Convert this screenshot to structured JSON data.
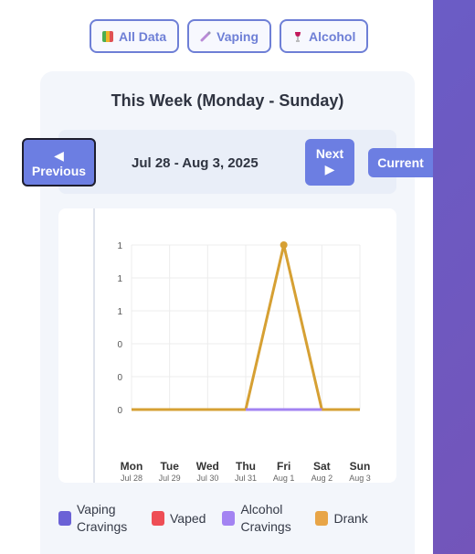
{
  "filters": [
    {
      "label": "All Data",
      "icon": "bar-chart-icon"
    },
    {
      "label": "Vaping",
      "icon": "vape-icon"
    },
    {
      "label": "Alcohol",
      "icon": "wine-glass-icon"
    }
  ],
  "card": {
    "title": "This Week (Monday - Sunday)",
    "range": "Jul 28 - Aug 3, 2025",
    "prev_arrow": "◀",
    "prev_label": "Previous",
    "next_label": "Next",
    "next_arrow": "▶",
    "current_label": "Current"
  },
  "chart_data": {
    "type": "line",
    "categories": [
      "Mon",
      "Tue",
      "Wed",
      "Thu",
      "Fri",
      "Sat",
      "Sun"
    ],
    "dates": [
      "Jul 28",
      "Jul 29",
      "Jul 30",
      "Jul 31",
      "Aug 1",
      "Aug 2",
      "Aug 3"
    ],
    "ytick_labels": [
      "1",
      "1",
      "1",
      "0",
      "0",
      "0"
    ],
    "ylim": [
      0,
      1
    ],
    "grid": true,
    "series": [
      {
        "name": "Vaping Cravings",
        "color": "#6b62d6",
        "values": [
          0,
          0,
          0,
          0,
          0,
          0,
          0
        ]
      },
      {
        "name": "Vaped",
        "color": "#ee4e55",
        "values": [
          0,
          0,
          0,
          0,
          0,
          0,
          0
        ]
      },
      {
        "name": "Alcohol Cravings",
        "color": "#a383f2",
        "values": [
          0,
          0,
          0,
          0,
          0,
          0,
          0
        ]
      },
      {
        "name": "Drank",
        "color": "#d6a033",
        "values": [
          0,
          0,
          0,
          0,
          1,
          0,
          0
        ]
      }
    ]
  },
  "legend": [
    {
      "label": "Vaping Cravings",
      "color": "#6b62d6"
    },
    {
      "label": "Vaped",
      "color": "#ee4e55"
    },
    {
      "label": "Alcohol Cravings",
      "color": "#a383f2"
    },
    {
      "label": "Drank",
      "color": "#e8a547"
    }
  ]
}
